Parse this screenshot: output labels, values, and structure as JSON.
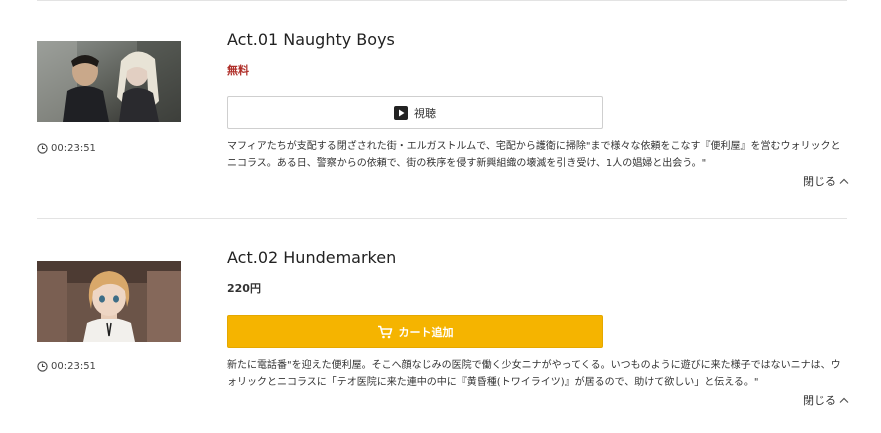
{
  "episodes": [
    {
      "title": "Act.01 Naughty Boys",
      "price": "無料",
      "duration": "00:23:51",
      "button_label": "視聴",
      "button_icon": "play-icon",
      "description": "マフィアたちが支配する閉ざされた街・エルガストルムで、宅配から護衛に掃除\"まで様々な依頼をこなす『便利屋』を営むウォリックとニコラス。ある日、警察からの依頼で、街の秩序を侵す新興組織の壊滅を引き受け、1人の娼婦と出会う。\"",
      "collapse_label": "閉じる"
    },
    {
      "title": "Act.02 Hundemarken",
      "price": "220円",
      "duration": "00:23:51",
      "button_label": "カート追加",
      "button_icon": "cart-icon",
      "description": "新たに電話番\"を迎えた便利屋。そこへ顔なじみの医院で働く少女ニナがやってくる。いつものように遊びに来た様子ではないニナは、ウォリックとニコラスに「テオ医院に来た連中の中に『黄昏種(トワイライツ)』が居るので、助けて欲しい」と伝える。\"",
      "collapse_label": "閉じる"
    }
  ],
  "colors": {
    "free_price": "#b0302a",
    "cart_button": "#f5b400",
    "divider": "#e3e3e3"
  }
}
